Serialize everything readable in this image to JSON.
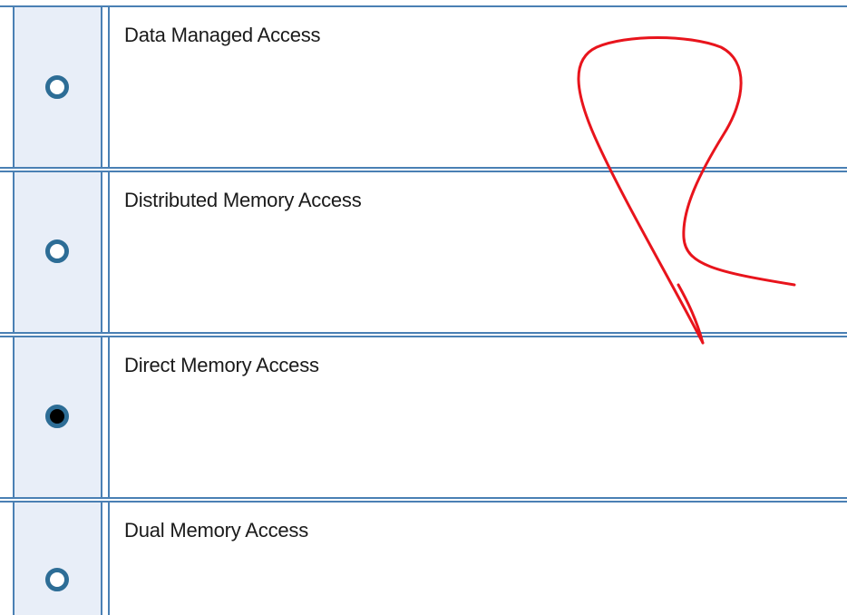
{
  "options": [
    {
      "label": "Data Managed Access",
      "selected": false
    },
    {
      "label": "Distributed Memory Access",
      "selected": false
    },
    {
      "label": "Direct Memory Access",
      "selected": true
    },
    {
      "label": "Dual Memory Access",
      "selected": false
    }
  ],
  "colors": {
    "border": "#4a80b4",
    "radio_ring": "#2d6d96",
    "radio_cell_bg": "#e8eef8",
    "annotation_stroke": "#e8141c"
  },
  "icons": {
    "radio_unselected": "radio-unselected-icon",
    "radio_selected": "radio-selected-icon",
    "annotation": "hand-drawn-arrow-icon"
  }
}
